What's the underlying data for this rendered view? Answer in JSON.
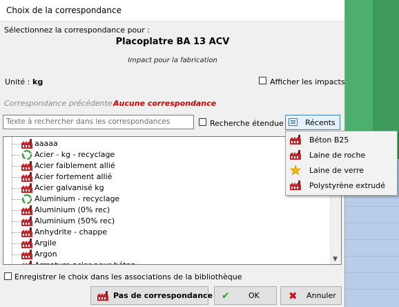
{
  "dialog": {
    "title": "Choix de la correspondance",
    "prompt": "Sélectionnez la correspondance pour :",
    "product_name": "Placoplatre BA 13 ACV",
    "impact_label": "Impact pour la fabrication",
    "unit_label": "Unité :",
    "unit_value": "kg",
    "show_impacts_label": "Afficher les impacts",
    "show_impacts_checked": false,
    "previous_label": "Correspondance précédente :",
    "previous_value": "Aucune correspondance",
    "search_placeholder": "Texte à rechercher dans les correspondances",
    "extended_search_label": "Recherche étendue",
    "extended_search_checked": false,
    "recent_button_label": "Récents",
    "save_choice_label": "Enregistrer le choix dans les associations de la bibliothèque",
    "save_choice_checked": false,
    "buttons": {
      "none": "Pas de correspondance",
      "ok": "OK",
      "cancel": "Annuler"
    }
  },
  "tree_items": [
    {
      "label": "aaaaa",
      "icon": "factory-icon"
    },
    {
      "label": "Acier - kg - recyclage",
      "icon": "recycle-icon"
    },
    {
      "label": "Acier faiblement allié",
      "icon": "factory-icon"
    },
    {
      "label": "Acier fortement allié",
      "icon": "factory-icon"
    },
    {
      "label": "Acier galvanisé kg",
      "icon": "factory-icon"
    },
    {
      "label": "Aluminium - recyclage",
      "icon": "recycle-icon"
    },
    {
      "label": "Aluminium (0% rec)",
      "icon": "factory-icon"
    },
    {
      "label": "Aluminium (50% rec)",
      "icon": "factory-icon"
    },
    {
      "label": "Anhydrite - chappe",
      "icon": "factory-icon"
    },
    {
      "label": "Argile",
      "icon": "factory-icon"
    },
    {
      "label": "Argon",
      "icon": "factory-icon"
    },
    {
      "label": "Armature acier pour béton",
      "icon": "factory-icon"
    }
  ],
  "recent_items": [
    {
      "label": "Béton B25",
      "icon": "factory-icon"
    },
    {
      "label": "Laine de roche",
      "icon": "factory-icon"
    },
    {
      "label": "Laine de verre",
      "icon": "star-icon"
    },
    {
      "label": "Polystyrène extrudé",
      "icon": "factory-icon"
    }
  ],
  "colors": {
    "accent": "#3c7fb1",
    "warning_text": "#d40000",
    "factory": "#c0262c",
    "recycle": "#3b9e3b",
    "star": "#f2b705"
  }
}
